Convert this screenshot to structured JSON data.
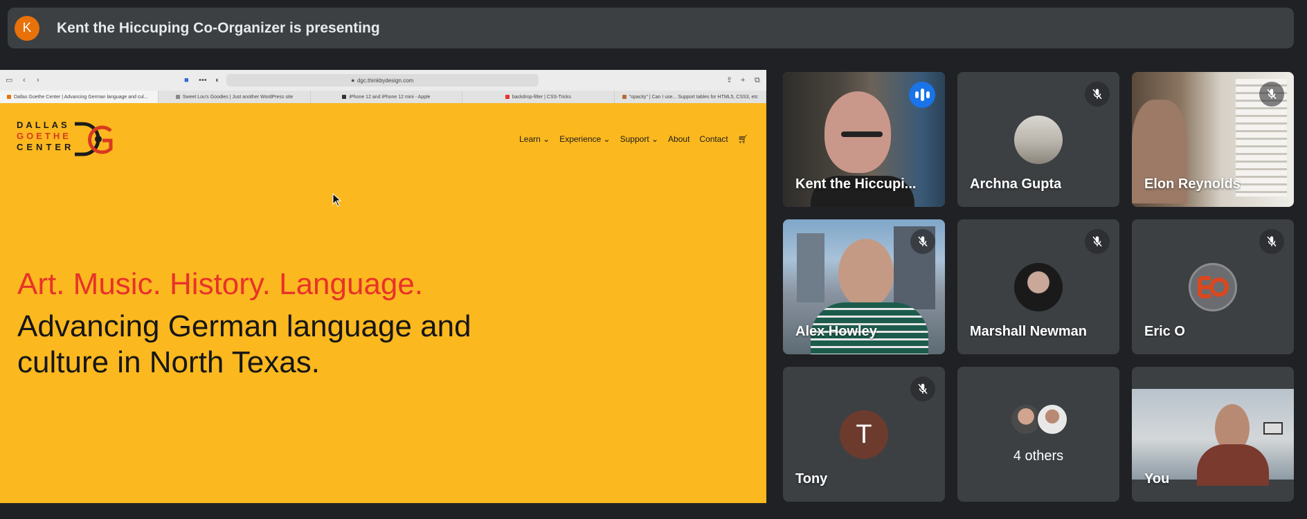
{
  "presenter_banner": {
    "avatar_letter": "K",
    "text": "Kent the Hiccuping Co-Organizer is presenting"
  },
  "shared_screen": {
    "url": "dgc.thinkbydesign.com",
    "tabs": [
      "Dallas Goethe Center | Advancing German language and cul...",
      "Sweet Lou's Goodies | Just another WordPress site",
      "iPhone 12 and iPhone 12 mini - Apple",
      "backdrop-filter | CSS-Tricks",
      "\"opacity\" | Can I use... Support tables for HTML5, CSS3, etc"
    ],
    "logo": {
      "line1": "DALLAS",
      "line2": "GOETHE",
      "line3": "CENTER"
    },
    "nav": [
      "Learn ⌄",
      "Experience ⌄",
      "Support ⌄",
      "About",
      "Contact"
    ],
    "hero_tagline": "Art. Music. History. Language.",
    "hero_heading": "Advancing German language and culture in North Texas."
  },
  "participants": [
    {
      "name": "Kent the Hiccupi...",
      "speaking": true
    },
    {
      "name": "Archna Gupta",
      "muted": true
    },
    {
      "name": "Elon Reynolds",
      "muted": true
    },
    {
      "name": "Alex Howley",
      "muted": true
    },
    {
      "name": "Marshall Newman",
      "muted": true
    },
    {
      "name": "Eric O",
      "muted": true
    },
    {
      "name": "Tony",
      "avatar_letter": "T",
      "muted": true
    },
    {
      "name": "4 others"
    },
    {
      "name": "You"
    }
  ],
  "colors": {
    "background": "#202124",
    "tile": "#3c4043",
    "accent": "#1a73e8",
    "site_yellow": "#fbb81f",
    "site_red": "#e8322a"
  },
  "icons": {
    "muted": "mic-off-icon",
    "speaking": "audio-bars-icon",
    "cart": "cart-icon"
  }
}
